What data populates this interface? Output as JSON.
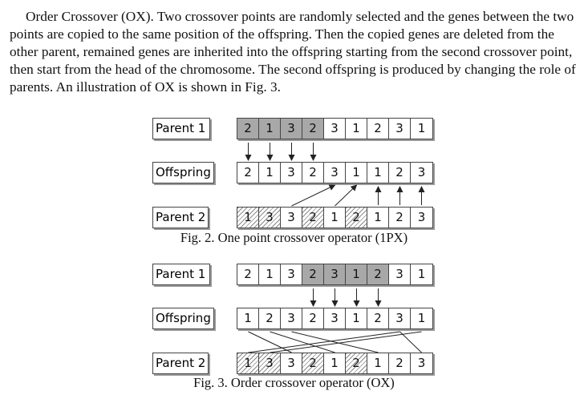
{
  "paragraph": [
    "Order Crossover (OX). Two crossover points are randomly selected and the genes between the two",
    "points are copied to the same position of the offspring. Then the copied genes are deleted from the",
    "other parent, remained genes are inherited into the offspring starting from the second crossover point,",
    "then start from the head of the chromosome. The second offspring is produced by changing the role of",
    "parents. An illustration of OX is shown in Fig. 3."
  ],
  "fig2": {
    "caption": "Fig. 2. One point crossover operator (1PX)",
    "rows": [
      {
        "label": "Parent 1",
        "genes": [
          "2",
          "1",
          "3",
          "2",
          "3",
          "1",
          "2",
          "3",
          "1"
        ],
        "style": [
          "gray",
          "gray",
          "gray",
          "gray",
          "plain",
          "plain",
          "plain",
          "plain",
          "plain"
        ]
      },
      {
        "label": "Offspring",
        "genes": [
          "2",
          "1",
          "3",
          "2",
          "3",
          "1",
          "1",
          "2",
          "3"
        ],
        "style": [
          "plain",
          "plain",
          "plain",
          "plain",
          "plain",
          "plain",
          "plain",
          "plain",
          "plain"
        ]
      },
      {
        "label": "Parent 2",
        "genes": [
          "1",
          "3",
          "3",
          "2",
          "1",
          "2",
          "1",
          "2",
          "3"
        ],
        "style": [
          "hatch",
          "hatch",
          "plain",
          "hatch",
          "plain",
          "hatch",
          "plain",
          "plain",
          "plain"
        ]
      }
    ]
  },
  "fig3": {
    "caption": "Fig. 3. Order crossover operator (OX)",
    "rows": [
      {
        "label": "Parent 1",
        "genes": [
          "2",
          "1",
          "3",
          "2",
          "3",
          "1",
          "2",
          "3",
          "1"
        ],
        "style": [
          "plain",
          "plain",
          "plain",
          "gray",
          "gray",
          "gray",
          "gray",
          "plain",
          "plain"
        ]
      },
      {
        "label": "Offspring",
        "genes": [
          "1",
          "2",
          "3",
          "2",
          "3",
          "1",
          "2",
          "3",
          "1"
        ],
        "style": [
          "plain",
          "plain",
          "plain",
          "plain",
          "plain",
          "plain",
          "plain",
          "plain",
          "plain"
        ]
      },
      {
        "label": "Parent 2",
        "genes": [
          "1",
          "3",
          "3",
          "2",
          "1",
          "2",
          "1",
          "2",
          "3"
        ],
        "style": [
          "hatch",
          "hatch",
          "plain",
          "hatch",
          "plain",
          "hatch",
          "plain",
          "plain",
          "plain"
        ]
      }
    ]
  }
}
